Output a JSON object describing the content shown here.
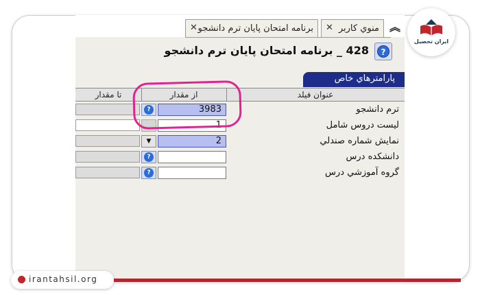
{
  "tabs": [
    {
      "label": "برنامه امتحان پايان ترم دانشجو",
      "close": "✕"
    },
    {
      "label": "منوي کاربر",
      "close": "✕"
    }
  ],
  "page_title": "428 _ برنامه امتحان پايان ترم دانشجو",
  "params_tab": "پارامترهاي خاص",
  "columns": {
    "to": "تا مقدار",
    "from": "از مقدار",
    "field": "عنوان فيلد"
  },
  "rows": [
    {
      "label": "ترم دانشجو",
      "from_value": "3983"
    },
    {
      "label": "ليست دروس شامل",
      "from_value": "1"
    },
    {
      "label": "نمايش شماره صندلي",
      "from_value": "2"
    },
    {
      "label": "دانشکده درس",
      "from_value": ""
    },
    {
      "label": "گروه آموزشي درس",
      "from_value": ""
    }
  ],
  "icons": {
    "help": "question-mark-icon",
    "collapse": "chevron-up-icon",
    "dropdown": "triangle-down-icon"
  },
  "brand": {
    "logo_text": "ايران تحصيل",
    "site": "irantahsil.org"
  },
  "colors": {
    "accent": "#1f2d8a",
    "highlight_field": "#b6bff0",
    "annotation": "#e0238f",
    "brand_red": "#b3262d"
  }
}
